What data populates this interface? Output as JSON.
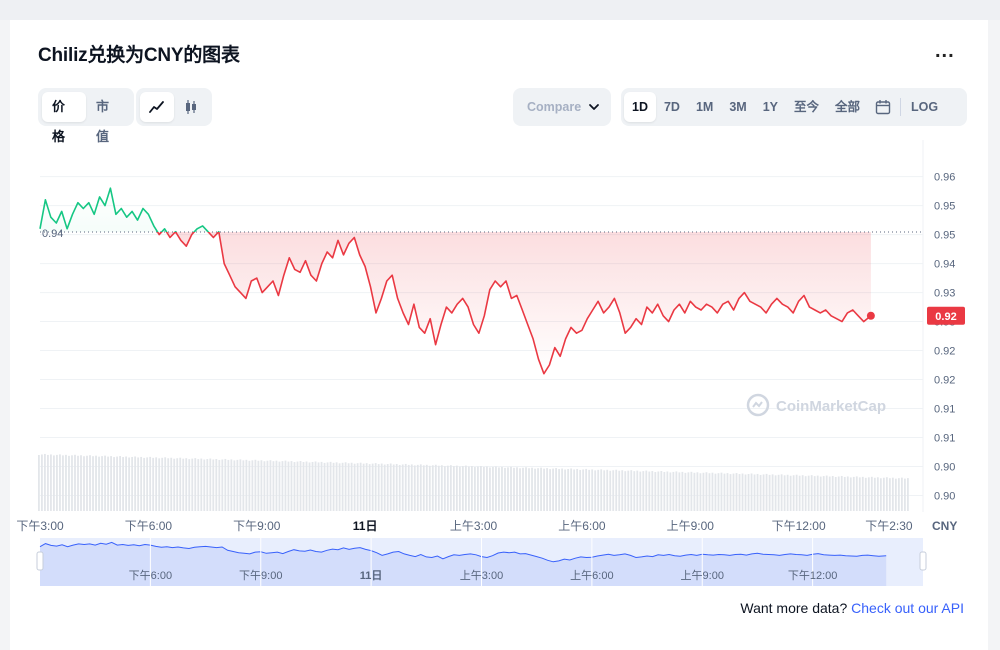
{
  "title": "Chiliz兑换为CNY的图表",
  "more_label": "...",
  "tabs_type": [
    {
      "label": "价格",
      "active": true
    },
    {
      "label": "市值",
      "active": false
    }
  ],
  "chart_styles": [
    {
      "icon": "line-chart-icon",
      "active": true
    },
    {
      "icon": "candlestick-icon",
      "active": false
    }
  ],
  "compare_label": "Compare with",
  "ranges": [
    {
      "label": "1D",
      "active": true
    },
    {
      "label": "7D",
      "active": false
    },
    {
      "label": "1M",
      "active": false
    },
    {
      "label": "3M",
      "active": false
    },
    {
      "label": "1Y",
      "active": false
    },
    {
      "label": "至今",
      "active": false
    },
    {
      "label": "全部",
      "active": false
    }
  ],
  "log_label": "LOG",
  "watermark": "CoinMarketCap",
  "footer": {
    "text": "Want more data?",
    "link": "Check out our API"
  },
  "chart_data": {
    "type": "line",
    "currency": "CNY",
    "reference_price": 0.9449,
    "reference_label": "0.94",
    "current_price_label": "0.92",
    "y_ticks": [
      {
        "v": 0.964,
        "label": "0.96"
      },
      {
        "v": 0.954,
        "label": "0.95"
      },
      {
        "v": 0.944,
        "label": "0.95"
      },
      {
        "v": 0.934,
        "label": "0.94"
      },
      {
        "v": 0.924,
        "label": "0.93"
      },
      {
        "v": 0.914,
        "label": "0.93"
      },
      {
        "v": 0.904,
        "label": "0.92"
      },
      {
        "v": 0.894,
        "label": "0.92"
      },
      {
        "v": 0.884,
        "label": "0.91"
      },
      {
        "v": 0.874,
        "label": "0.91"
      },
      {
        "v": 0.864,
        "label": "0.90"
      },
      {
        "v": 0.854,
        "label": "0.90"
      }
    ],
    "ylim": [
      0.849,
      0.968
    ],
    "x_ticks": [
      {
        "h": 0,
        "label": "下午3:00",
        "bold": false
      },
      {
        "h": 3,
        "label": "下午6:00",
        "bold": false
      },
      {
        "h": 6,
        "label": "下午9:00",
        "bold": false
      },
      {
        "h": 9,
        "label": "11日",
        "bold": true
      },
      {
        "h": 12,
        "label": "上午3:00",
        "bold": false
      },
      {
        "h": 15,
        "label": "上午6:00",
        "bold": false
      },
      {
        "h": 18,
        "label": "上午9:00",
        "bold": false
      },
      {
        "h": 21,
        "label": "下午12:00",
        "bold": false
      },
      {
        "h": 23.5,
        "label": "下午2:30",
        "bold": false
      }
    ],
    "nav_ticks": [
      {
        "h": 3,
        "label": "下午6:00",
        "bold": false
      },
      {
        "h": 6,
        "label": "下午9:00",
        "bold": false
      },
      {
        "h": 9,
        "label": "11日",
        "bold": true
      },
      {
        "h": 12,
        "label": "上午3:00",
        "bold": false
      },
      {
        "h": 15,
        "label": "上午6:00",
        "bold": false
      },
      {
        "h": 18,
        "label": "上午9:00",
        "bold": false
      },
      {
        "h": 21,
        "label": "下午12:00",
        "bold": false
      }
    ],
    "xlim": [
      0,
      24.0
    ],
    "series": [
      {
        "values": [
          [
            0.0,
            0.946
          ],
          [
            0.15,
            0.956
          ],
          [
            0.3,
            0.95
          ],
          [
            0.45,
            0.948
          ],
          [
            0.6,
            0.952
          ],
          [
            0.75,
            0.946
          ],
          [
            0.9,
            0.951
          ],
          [
            1.05,
            0.955
          ],
          [
            1.2,
            0.953
          ],
          [
            1.35,
            0.955
          ],
          [
            1.5,
            0.951
          ],
          [
            1.65,
            0.957
          ],
          [
            1.8,
            0.954
          ],
          [
            1.95,
            0.96
          ],
          [
            2.1,
            0.951
          ],
          [
            2.25,
            0.953
          ],
          [
            2.4,
            0.95
          ],
          [
            2.55,
            0.952
          ],
          [
            2.7,
            0.949
          ],
          [
            2.85,
            0.953
          ],
          [
            3.0,
            0.951
          ],
          [
            3.15,
            0.947
          ],
          [
            3.3,
            0.944
          ],
          [
            3.45,
            0.946
          ],
          [
            3.6,
            0.943
          ],
          [
            3.75,
            0.945
          ],
          [
            3.9,
            0.942
          ],
          [
            4.05,
            0.94
          ],
          [
            4.2,
            0.944
          ],
          [
            4.35,
            0.946
          ],
          [
            4.5,
            0.947
          ],
          [
            4.65,
            0.945
          ],
          [
            4.8,
            0.943
          ],
          [
            4.95,
            0.945
          ],
          [
            5.1,
            0.934
          ],
          [
            5.25,
            0.93
          ],
          [
            5.4,
            0.926
          ],
          [
            5.55,
            0.924
          ],
          [
            5.7,
            0.922
          ],
          [
            5.85,
            0.928
          ],
          [
            6.0,
            0.929
          ],
          [
            6.15,
            0.924
          ],
          [
            6.3,
            0.926
          ],
          [
            6.45,
            0.928
          ],
          [
            6.6,
            0.923
          ],
          [
            6.75,
            0.93
          ],
          [
            6.9,
            0.936
          ],
          [
            7.05,
            0.932
          ],
          [
            7.2,
            0.931
          ],
          [
            7.35,
            0.935
          ],
          [
            7.5,
            0.93
          ],
          [
            7.65,
            0.928
          ],
          [
            7.8,
            0.934
          ],
          [
            7.95,
            0.938
          ],
          [
            8.1,
            0.936
          ],
          [
            8.25,
            0.942
          ],
          [
            8.4,
            0.937
          ],
          [
            8.55,
            0.941
          ],
          [
            8.7,
            0.943
          ],
          [
            8.85,
            0.937
          ],
          [
            9.0,
            0.933
          ],
          [
            9.15,
            0.926
          ],
          [
            9.3,
            0.917
          ],
          [
            9.45,
            0.922
          ],
          [
            9.6,
            0.928
          ],
          [
            9.75,
            0.93
          ],
          [
            9.9,
            0.922
          ],
          [
            10.05,
            0.917
          ],
          [
            10.2,
            0.913
          ],
          [
            10.35,
            0.92
          ],
          [
            10.5,
            0.912
          ],
          [
            10.65,
            0.91
          ],
          [
            10.8,
            0.915
          ],
          [
            10.95,
            0.906
          ],
          [
            11.1,
            0.913
          ],
          [
            11.25,
            0.919
          ],
          [
            11.4,
            0.917
          ],
          [
            11.55,
            0.92
          ],
          [
            11.7,
            0.922
          ],
          [
            11.85,
            0.919
          ],
          [
            12.0,
            0.913
          ],
          [
            12.15,
            0.91
          ],
          [
            12.3,
            0.916
          ],
          [
            12.45,
            0.925
          ],
          [
            12.6,
            0.928
          ],
          [
            12.75,
            0.926
          ],
          [
            12.9,
            0.928
          ],
          [
            13.05,
            0.922
          ],
          [
            13.2,
            0.923
          ],
          [
            13.35,
            0.918
          ],
          [
            13.5,
            0.913
          ],
          [
            13.65,
            0.908
          ],
          [
            13.8,
            0.901
          ],
          [
            13.95,
            0.896
          ],
          [
            14.1,
            0.899
          ],
          [
            14.25,
            0.905
          ],
          [
            14.4,
            0.902
          ],
          [
            14.55,
            0.908
          ],
          [
            14.7,
            0.912
          ],
          [
            14.85,
            0.91
          ],
          [
            15.0,
            0.911
          ],
          [
            15.15,
            0.915
          ],
          [
            15.3,
            0.918
          ],
          [
            15.45,
            0.921
          ],
          [
            15.6,
            0.917
          ],
          [
            15.75,
            0.919
          ],
          [
            15.9,
            0.922
          ],
          [
            16.05,
            0.917
          ],
          [
            16.2,
            0.91
          ],
          [
            16.35,
            0.912
          ],
          [
            16.5,
            0.915
          ],
          [
            16.65,
            0.913
          ],
          [
            16.8,
            0.919
          ],
          [
            16.95,
            0.917
          ],
          [
            17.1,
            0.92
          ],
          [
            17.25,
            0.916
          ],
          [
            17.4,
            0.914
          ],
          [
            17.55,
            0.918
          ],
          [
            17.7,
            0.92
          ],
          [
            17.85,
            0.917
          ],
          [
            18.0,
            0.921
          ],
          [
            18.15,
            0.919
          ],
          [
            18.3,
            0.918
          ],
          [
            18.45,
            0.92
          ],
          [
            18.6,
            0.919
          ],
          [
            18.75,
            0.917
          ],
          [
            18.9,
            0.92
          ],
          [
            19.05,
            0.921
          ],
          [
            19.2,
            0.918
          ],
          [
            19.35,
            0.922
          ],
          [
            19.5,
            0.924
          ],
          [
            19.65,
            0.921
          ],
          [
            19.8,
            0.92
          ],
          [
            19.95,
            0.919
          ],
          [
            20.1,
            0.917
          ],
          [
            20.25,
            0.92
          ],
          [
            20.4,
            0.922
          ],
          [
            20.55,
            0.92
          ],
          [
            20.7,
            0.919
          ],
          [
            20.85,
            0.917
          ],
          [
            21.0,
            0.921
          ],
          [
            21.15,
            0.923
          ],
          [
            21.3,
            0.919
          ],
          [
            21.45,
            0.918
          ],
          [
            21.6,
            0.917
          ],
          [
            21.75,
            0.918
          ],
          [
            21.9,
            0.916
          ],
          [
            22.05,
            0.915
          ],
          [
            22.2,
            0.914
          ],
          [
            22.35,
            0.917
          ],
          [
            22.5,
            0.918
          ],
          [
            22.65,
            0.916
          ],
          [
            22.8,
            0.914
          ],
          [
            23.0,
            0.916
          ]
        ]
      }
    ],
    "volume_bars": 0
  }
}
